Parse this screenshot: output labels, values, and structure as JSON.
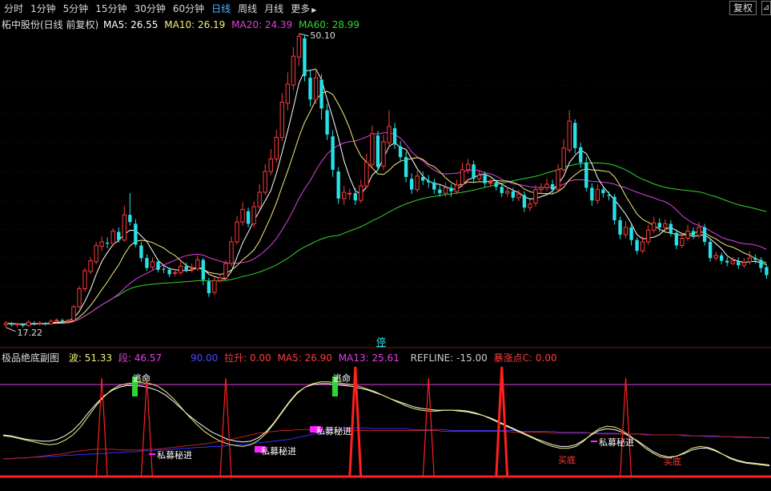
{
  "toolbar": {
    "periods": [
      "分时",
      "1分钟",
      "5分钟",
      "15分钟",
      "30分钟",
      "60分钟",
      "日线",
      "周线",
      "月线",
      "更多"
    ],
    "active": "日线",
    "more_arrow": "▶",
    "adjust_btn": "复权",
    "corner_btn": "⊿"
  },
  "colors": {
    "up": "#ff3b3b",
    "down": "#27e1e6",
    "ma5": "#ffffff",
    "ma10": "#f2f07a",
    "ma20": "#e040e0",
    "ma60": "#2fd62f",
    "cyan": "#27e1e6"
  },
  "main_legend": {
    "title": "柘中股份(日线 前复权)",
    "ma5": "MA5: 26.55",
    "ma10": "MA10: 26.19",
    "ma20": "MA20: 24.39",
    "ma60": "MA60: 28.99"
  },
  "sub_legend": {
    "title": "极品绝底副图",
    "bo": "波: 51.33",
    "duan": "段: 46.57",
    "level": "90.00",
    "lasheng": "拉升: 0.00",
    "ma5": "MA5: 26.90",
    "ma13": "MA13: 25.61",
    "refline": "REFLINE: -15.00",
    "bzd": "暴涨点C: 0.00"
  },
  "chart_data": {
    "type": "candlestick",
    "high_label": "50.10",
    "low_label": "17.22",
    "y_high": 50.1,
    "y_low": 17.22,
    "stop_marker": "停",
    "candles": [
      [
        17.8,
        18.0,
        18.2,
        17.5
      ],
      [
        17.9,
        17.8,
        18.1,
        17.6
      ],
      [
        17.8,
        17.9,
        18.0,
        17.5
      ],
      [
        17.9,
        17.7,
        18.0,
        17.5
      ],
      [
        17.7,
        18.1,
        18.3,
        17.6
      ],
      [
        18.0,
        17.9,
        18.2,
        17.7
      ],
      [
        17.9,
        18.0,
        18.2,
        17.7
      ],
      [
        18.0,
        17.9,
        18.1,
        17.7
      ],
      [
        17.9,
        18.2,
        18.4,
        17.8
      ],
      [
        18.2,
        18.3,
        18.5,
        18.0
      ],
      [
        18.3,
        18.2,
        18.5,
        18.0
      ],
      [
        18.2,
        18.3,
        18.4,
        17.9
      ],
      [
        18.3,
        19.8,
        20.0,
        18.2
      ],
      [
        19.8,
        21.8,
        22.1,
        19.6
      ],
      [
        21.8,
        23.8,
        24.1,
        21.5
      ],
      [
        23.7,
        24.9,
        25.3,
        23.4
      ],
      [
        24.8,
        26.6,
        27.0,
        24.5
      ],
      [
        26.5,
        27.0,
        27.6,
        26.0
      ],
      [
        26.9,
        26.8,
        27.5,
        26.3
      ],
      [
        26.8,
        28.2,
        28.5,
        26.5
      ],
      [
        28.1,
        27.2,
        28.6,
        26.9
      ],
      [
        27.2,
        30.0,
        31.0,
        27.0
      ],
      [
        30.0,
        29.2,
        32.4,
        28.8
      ],
      [
        29.0,
        26.7,
        29.5,
        26.4
      ],
      [
        26.6,
        25.2,
        27.0,
        24.8
      ],
      [
        25.2,
        24.1,
        25.6,
        23.8
      ],
      [
        24.2,
        24.8,
        25.3,
        23.9
      ],
      [
        24.8,
        23.9,
        25.1,
        23.6
      ],
      [
        24.0,
        23.9,
        24.4,
        23.5
      ],
      [
        23.9,
        23.4,
        24.2,
        23.1
      ],
      [
        23.5,
        23.6,
        24.0,
        23.2
      ],
      [
        23.6,
        24.3,
        24.8,
        23.3
      ],
      [
        24.3,
        23.9,
        24.7,
        23.6
      ],
      [
        23.9,
        24.0,
        24.6,
        23.6
      ],
      [
        24.0,
        25.0,
        25.5,
        23.8
      ],
      [
        25.0,
        22.8,
        25.2,
        22.2
      ],
      [
        22.6,
        21.3,
        23.0,
        20.9
      ],
      [
        21.4,
        22.7,
        23.1,
        21.1
      ],
      [
        22.7,
        23.0,
        23.4,
        22.5
      ],
      [
        23.0,
        24.6,
        25.0,
        22.8
      ],
      [
        24.6,
        27.0,
        27.6,
        24.3
      ],
      [
        27.0,
        29.2,
        29.9,
        26.7
      ],
      [
        29.2,
        30.6,
        31.4,
        28.8
      ],
      [
        30.4,
        29.0,
        30.8,
        28.6
      ],
      [
        29.0,
        30.9,
        31.5,
        28.6
      ],
      [
        30.9,
        32.5,
        33.4,
        30.5
      ],
      [
        32.5,
        34.8,
        35.6,
        32.2
      ],
      [
        34.8,
        36.2,
        37.3,
        34.4
      ],
      [
        36.2,
        38.6,
        39.4,
        35.8
      ],
      [
        38.6,
        42.5,
        43.5,
        38.2
      ],
      [
        42.4,
        44.5,
        45.8,
        41.6
      ],
      [
        44.4,
        47.6,
        48.6,
        43.8
      ],
      [
        47.5,
        49.8,
        50.1,
        46.5
      ],
      [
        49.6,
        45.4,
        50.0,
        44.8
      ],
      [
        45.2,
        42.8,
        46.0,
        42.0
      ],
      [
        42.8,
        45.2,
        46.3,
        42.3
      ],
      [
        45.0,
        41.8,
        45.6,
        40.6
      ],
      [
        41.6,
        38.9,
        42.3,
        38.3
      ],
      [
        38.7,
        35.0,
        39.4,
        34.2
      ],
      [
        34.8,
        31.8,
        35.3,
        31.2
      ],
      [
        31.8,
        32.5,
        33.2,
        31.1
      ],
      [
        32.3,
        32.4,
        32.9,
        31.7
      ],
      [
        32.4,
        31.6,
        33.0,
        31.1
      ],
      [
        31.6,
        33.2,
        33.9,
        31.3
      ],
      [
        33.2,
        35.8,
        36.8,
        33.0
      ],
      [
        35.6,
        39.0,
        39.9,
        35.2
      ],
      [
        38.8,
        35.3,
        39.3,
        34.9
      ],
      [
        35.4,
        38.1,
        38.9,
        35.0
      ],
      [
        38.0,
        39.8,
        41.6,
        37.6
      ],
      [
        39.6,
        37.8,
        40.2,
        37.3
      ],
      [
        37.6,
        36.4,
        38.2,
        36.0
      ],
      [
        36.4,
        34.2,
        37.0,
        33.6
      ],
      [
        34.0,
        32.8,
        34.6,
        32.3
      ],
      [
        32.8,
        34.3,
        34.9,
        32.5
      ],
      [
        34.2,
        33.8,
        34.8,
        33.3
      ],
      [
        33.8,
        33.6,
        34.4,
        33.0
      ],
      [
        33.6,
        32.8,
        34.0,
        32.3
      ],
      [
        32.8,
        32.4,
        33.3,
        32.0
      ],
      [
        32.4,
        33.0,
        33.6,
        32.0
      ],
      [
        33.0,
        32.6,
        33.4,
        32.0
      ],
      [
        32.6,
        33.3,
        33.9,
        32.3
      ],
      [
        33.4,
        35.0,
        35.8,
        33.1
      ],
      [
        35.0,
        35.6,
        36.2,
        34.6
      ],
      [
        35.6,
        34.0,
        36.0,
        33.5
      ],
      [
        34.0,
        34.4,
        34.9,
        33.6
      ],
      [
        34.4,
        33.5,
        34.8,
        33.1
      ],
      [
        33.5,
        33.6,
        34.0,
        33.1
      ],
      [
        33.6,
        33.1,
        33.9,
        32.7
      ],
      [
        33.1,
        32.4,
        33.6,
        32.0
      ],
      [
        32.4,
        32.6,
        33.1,
        32.0
      ],
      [
        32.6,
        31.9,
        33.0,
        31.5
      ],
      [
        31.9,
        32.3,
        32.8,
        31.5
      ],
      [
        32.2,
        30.8,
        32.6,
        30.3
      ],
      [
        30.8,
        31.2,
        31.7,
        30.4
      ],
      [
        31.3,
        32.8,
        33.3,
        30.9
      ],
      [
        32.8,
        33.0,
        33.5,
        32.4
      ],
      [
        33.0,
        33.4,
        34.0,
        32.6
      ],
      [
        33.4,
        32.8,
        33.9,
        32.4
      ],
      [
        32.8,
        35.0,
        35.6,
        32.6
      ],
      [
        35.0,
        37.4,
        38.4,
        34.8
      ],
      [
        37.2,
        40.4,
        41.6,
        36.9
      ],
      [
        40.2,
        37.4,
        40.6,
        36.8
      ],
      [
        37.5,
        35.8,
        38.0,
        35.2
      ],
      [
        35.8,
        33.0,
        36.4,
        32.6
      ],
      [
        33.0,
        31.6,
        33.5,
        31.0
      ],
      [
        31.6,
        32.8,
        33.4,
        31.2
      ],
      [
        32.8,
        32.4,
        33.2,
        31.9
      ],
      [
        32.2,
        32.1,
        32.6,
        31.6
      ],
      [
        32.0,
        29.4,
        32.3,
        28.9
      ],
      [
        29.4,
        27.8,
        29.8,
        27.3
      ],
      [
        27.8,
        28.6,
        29.3,
        27.4
      ],
      [
        28.6,
        27.2,
        29.0,
        26.6
      ],
      [
        27.2,
        26.0,
        27.5,
        25.6
      ],
      [
        26.0,
        27.0,
        27.6,
        25.7
      ],
      [
        27.0,
        28.3,
        28.9,
        26.7
      ],
      [
        28.3,
        29.1,
        29.8,
        28.0
      ],
      [
        29.1,
        28.6,
        29.6,
        28.1
      ],
      [
        28.6,
        29.0,
        29.5,
        28.2
      ],
      [
        29.0,
        28.0,
        29.4,
        27.6
      ],
      [
        28.0,
        26.6,
        28.4,
        26.2
      ],
      [
        26.6,
        27.4,
        27.9,
        26.3
      ],
      [
        27.4,
        28.2,
        28.9,
        27.1
      ],
      [
        28.2,
        27.7,
        28.6,
        27.3
      ],
      [
        27.7,
        28.6,
        29.2,
        27.4
      ],
      [
        28.6,
        27.0,
        29.0,
        26.6
      ],
      [
        27.0,
        25.2,
        27.3,
        24.8
      ],
      [
        25.2,
        25.5,
        25.9,
        24.9
      ],
      [
        25.5,
        24.9,
        25.8,
        24.5
      ],
      [
        24.9,
        24.7,
        25.3,
        24.3
      ],
      [
        24.6,
        24.9,
        25.3,
        24.4
      ],
      [
        24.9,
        24.4,
        25.3,
        24.0
      ],
      [
        24.4,
        24.7,
        25.2,
        24.1
      ],
      [
        24.8,
        25.2,
        26.0,
        24.5
      ],
      [
        25.2,
        25.0,
        25.6,
        24.6
      ],
      [
        25.0,
        24.1,
        25.3,
        23.6
      ],
      [
        24.2,
        23.3,
        24.5,
        22.9
      ]
    ],
    "sub": {
      "range": [
        -15,
        110
      ],
      "level_line": 90,
      "bo": [
        32,
        31,
        29,
        27,
        25,
        23,
        22,
        23,
        27,
        33,
        42,
        54,
        66,
        76,
        84,
        89,
        91,
        92,
        92,
        91,
        88,
        82,
        74,
        64,
        54,
        45,
        37,
        31,
        26,
        23,
        21,
        20,
        22,
        27,
        35,
        46,
        58,
        70,
        80,
        87,
        91,
        93,
        93,
        92,
        91,
        90,
        88,
        85,
        82,
        78,
        74,
        70,
        66,
        63,
        61,
        60,
        60,
        61,
        61,
        61,
        60,
        58,
        55,
        51,
        47,
        43,
        39,
        35,
        31,
        27,
        23,
        20,
        18,
        18,
        20,
        26,
        34,
        40,
        43,
        42,
        38,
        32,
        25,
        18,
        12,
        8,
        7,
        9,
        13,
        18,
        20,
        19,
        16,
        11,
        6,
        3,
        1,
        0,
        -1,
        -2
      ],
      "duan": [
        33,
        32,
        30,
        28,
        27,
        26,
        26,
        28,
        32,
        38,
        47,
        58,
        68,
        77,
        83,
        87,
        89,
        89,
        88,
        86,
        83,
        78,
        71,
        63,
        55,
        48,
        42,
        36,
        32,
        28,
        26,
        25,
        26,
        30,
        37,
        47,
        59,
        71,
        81,
        87,
        90,
        91,
        91,
        90,
        89,
        88,
        86,
        84,
        81,
        78,
        74,
        71,
        68,
        65,
        63,
        62,
        61,
        61,
        61,
        60,
        59,
        57,
        55,
        52,
        48,
        44,
        40,
        36,
        32,
        28,
        25,
        22,
        20,
        20,
        22,
        27,
        33,
        38,
        40,
        39,
        36,
        31,
        26,
        20,
        14,
        10,
        8,
        9,
        12,
        16,
        18,
        18,
        15,
        11,
        7,
        4,
        2,
        1,
        0,
        -1
      ],
      "blue": [
        6,
        6,
        7,
        7,
        8,
        8,
        9,
        9,
        10,
        10,
        11,
        11,
        12,
        12,
        13,
        13,
        14,
        14,
        15,
        15,
        16,
        16,
        17,
        18,
        18,
        19,
        19,
        20,
        20,
        21,
        22,
        22,
        23,
        24,
        25,
        26,
        27,
        28,
        30,
        32,
        34,
        36,
        38,
        39,
        40,
        41,
        41,
        41,
        40,
        40,
        40,
        40,
        40,
        39,
        39,
        39,
        39,
        39,
        38,
        38,
        38,
        38,
        38,
        38,
        38,
        38,
        38,
        37,
        37,
        37,
        37,
        37,
        36,
        36,
        36,
        36,
        35,
        35,
        35,
        35,
        34,
        34,
        34,
        34,
        33,
        33,
        33,
        33,
        32,
        32,
        32,
        31,
        31,
        31,
        31,
        30,
        30,
        30,
        30,
        29
      ],
      "red_line": [
        6,
        6,
        7,
        7,
        8,
        9,
        10,
        11,
        12,
        14,
        15,
        16,
        17,
        17,
        17,
        16,
        16,
        16,
        16,
        17,
        17,
        18,
        19,
        20,
        21,
        22,
        23,
        24,
        26,
        27,
        29,
        31,
        33,
        35,
        36,
        37,
        38,
        38,
        39,
        39,
        39,
        39,
        39,
        39,
        39,
        38,
        38,
        38,
        38,
        38,
        38,
        38,
        38,
        38,
        38,
        38,
        38,
        37,
        37,
        37,
        37,
        37,
        37,
        37,
        37,
        37,
        36,
        36,
        36,
        36,
        36,
        35,
        35,
        35,
        35,
        35,
        35,
        34,
        34,
        34,
        34,
        34,
        34,
        33,
        33,
        33,
        33,
        33,
        33,
        32,
        32,
        32,
        32,
        31,
        31,
        31,
        31,
        30,
        30,
        30
      ],
      "spikes": [
        17,
        39,
        62,
        75,
        110,
        161,
        224
      ],
      "labels": {
        "escape": "逃命",
        "private": "私募秘进",
        "bottom": "买底"
      }
    }
  }
}
